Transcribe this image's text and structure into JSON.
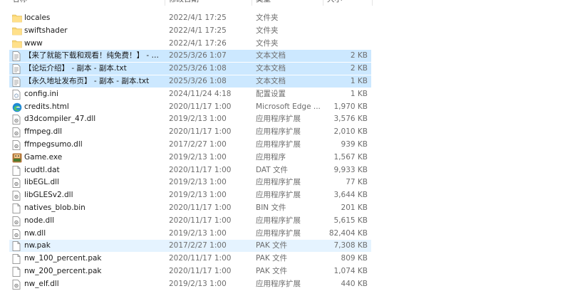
{
  "header": {
    "name": "名称",
    "date": "修改日期",
    "type": "类型",
    "size": "大小"
  },
  "files": [
    {
      "name": "locales",
      "date": "2022/4/1 17:25",
      "type": "文件夹",
      "size": "",
      "icon": "folder-icon",
      "state": ""
    },
    {
      "name": "swiftshader",
      "date": "2022/4/1 17:25",
      "type": "文件夹",
      "size": "",
      "icon": "folder-icon",
      "state": ""
    },
    {
      "name": "www",
      "date": "2022/4/1 17:26",
      "type": "文件夹",
      "size": "",
      "icon": "folder-icon",
      "state": ""
    },
    {
      "name": "【来了就能下载和观看！纯免费！】 - 副...",
      "date": "2025/3/26 1:07",
      "type": "文本文档",
      "size": "2 KB",
      "icon": "text-file-icon",
      "state": "selected"
    },
    {
      "name": "【论坛介绍】 - 副本 - 副本.txt",
      "date": "2025/3/26 1:08",
      "type": "文本文档",
      "size": "2 KB",
      "icon": "text-file-icon",
      "state": "selected"
    },
    {
      "name": "【永久地址发布页】 - 副本 - 副本.txt",
      "date": "2025/3/26 1:08",
      "type": "文本文档",
      "size": "1 KB",
      "icon": "text-file-icon",
      "state": "selected"
    },
    {
      "name": "config.ini",
      "date": "2024/11/24 4:18",
      "type": "配置设置",
      "size": "1 KB",
      "icon": "config-file-icon",
      "state": ""
    },
    {
      "name": "credits.html",
      "date": "2020/11/17 1:00",
      "type": "Microsoft Edge ...",
      "size": "1,970 KB",
      "icon": "edge-icon",
      "state": ""
    },
    {
      "name": "d3dcompiler_47.dll",
      "date": "2019/2/13 1:00",
      "type": "应用程序扩展",
      "size": "3,576 KB",
      "icon": "dll-file-icon",
      "state": ""
    },
    {
      "name": "ffmpeg.dll",
      "date": "2020/11/17 1:00",
      "type": "应用程序扩展",
      "size": "2,010 KB",
      "icon": "dll-file-icon",
      "state": ""
    },
    {
      "name": "ffmpegsumo.dll",
      "date": "2017/2/27 1:00",
      "type": "应用程序扩展",
      "size": "939 KB",
      "icon": "dll-file-icon",
      "state": ""
    },
    {
      "name": "Game.exe",
      "date": "2019/2/13 1:00",
      "type": "应用程序",
      "size": "1,567 KB",
      "icon": "game-exe-icon",
      "state": ""
    },
    {
      "name": "icudtl.dat",
      "date": "2020/11/17 1:00",
      "type": "DAT 文件",
      "size": "9,933 KB",
      "icon": "file-icon",
      "state": ""
    },
    {
      "name": "libEGL.dll",
      "date": "2019/2/13 1:00",
      "type": "应用程序扩展",
      "size": "77 KB",
      "icon": "dll-file-icon",
      "state": ""
    },
    {
      "name": "libGLESv2.dll",
      "date": "2019/2/13 1:00",
      "type": "应用程序扩展",
      "size": "3,644 KB",
      "icon": "dll-file-icon",
      "state": ""
    },
    {
      "name": "natives_blob.bin",
      "date": "2020/11/17 1:00",
      "type": "BIN 文件",
      "size": "201 KB",
      "icon": "file-icon",
      "state": ""
    },
    {
      "name": "node.dll",
      "date": "2020/11/17 1:00",
      "type": "应用程序扩展",
      "size": "5,615 KB",
      "icon": "dll-file-icon",
      "state": ""
    },
    {
      "name": "nw.dll",
      "date": "2019/2/13 1:00",
      "type": "应用程序扩展",
      "size": "82,404 KB",
      "icon": "dll-file-icon",
      "state": ""
    },
    {
      "name": "nw.pak",
      "date": "2017/2/27 1:00",
      "type": "PAK 文件",
      "size": "7,308 KB",
      "icon": "file-icon",
      "state": "hover"
    },
    {
      "name": "nw_100_percent.pak",
      "date": "2020/11/17 1:00",
      "type": "PAK 文件",
      "size": "809 KB",
      "icon": "file-icon",
      "state": ""
    },
    {
      "name": "nw_200_percent.pak",
      "date": "2020/11/17 1:00",
      "type": "PAK 文件",
      "size": "1,074 KB",
      "icon": "file-icon",
      "state": ""
    },
    {
      "name": "nw_elf.dll",
      "date": "2019/2/13 1:00",
      "type": "应用程序扩展",
      "size": "440 KB",
      "icon": "dll-file-icon",
      "state": ""
    }
  ]
}
